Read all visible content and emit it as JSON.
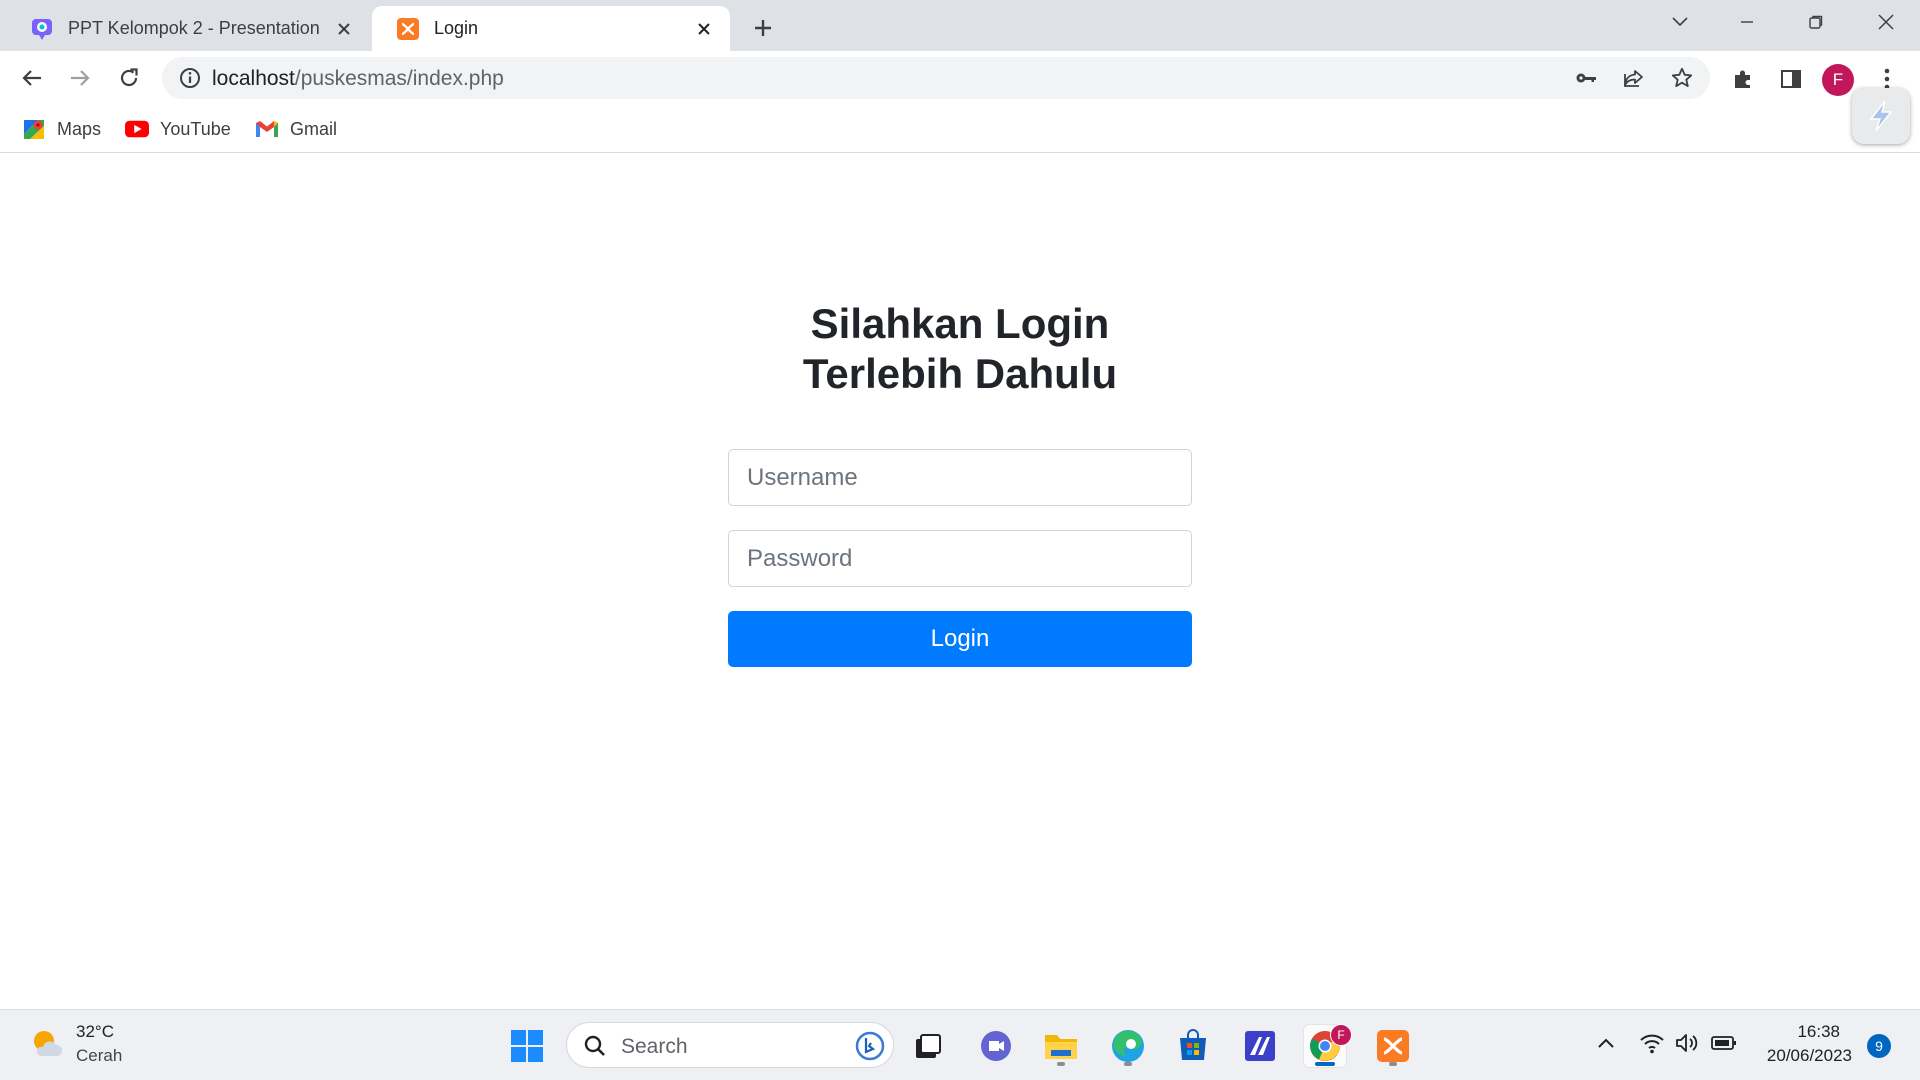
{
  "browser": {
    "tabs": [
      {
        "title": "PPT Kelompok 2 - Presentation",
        "active": false
      },
      {
        "title": "Login",
        "active": true
      }
    ],
    "url_host": "localhost",
    "url_path": "/puskesmas/index.php",
    "profile_initial": "F",
    "bookmarks": [
      {
        "label": "Maps",
        "icon": "maps-icon"
      },
      {
        "label": "YouTube",
        "icon": "youtube-icon"
      },
      {
        "label": "Gmail",
        "icon": "gmail-icon"
      }
    ]
  },
  "login": {
    "title": "Silahkan Login Terlebih Dahulu",
    "username_placeholder": "Username",
    "password_placeholder": "Password",
    "button_label": "Login"
  },
  "taskbar": {
    "weather_temp": "32°C",
    "weather_condition": "Cerah",
    "search_placeholder": "Search",
    "time": "16:38",
    "date": "20/06/2023",
    "notification_count": "9",
    "chrome_badge": "F"
  },
  "colors": {
    "primary": "#007bff",
    "tabstrip": "#dee1e6",
    "avatar": "#c2185b"
  }
}
